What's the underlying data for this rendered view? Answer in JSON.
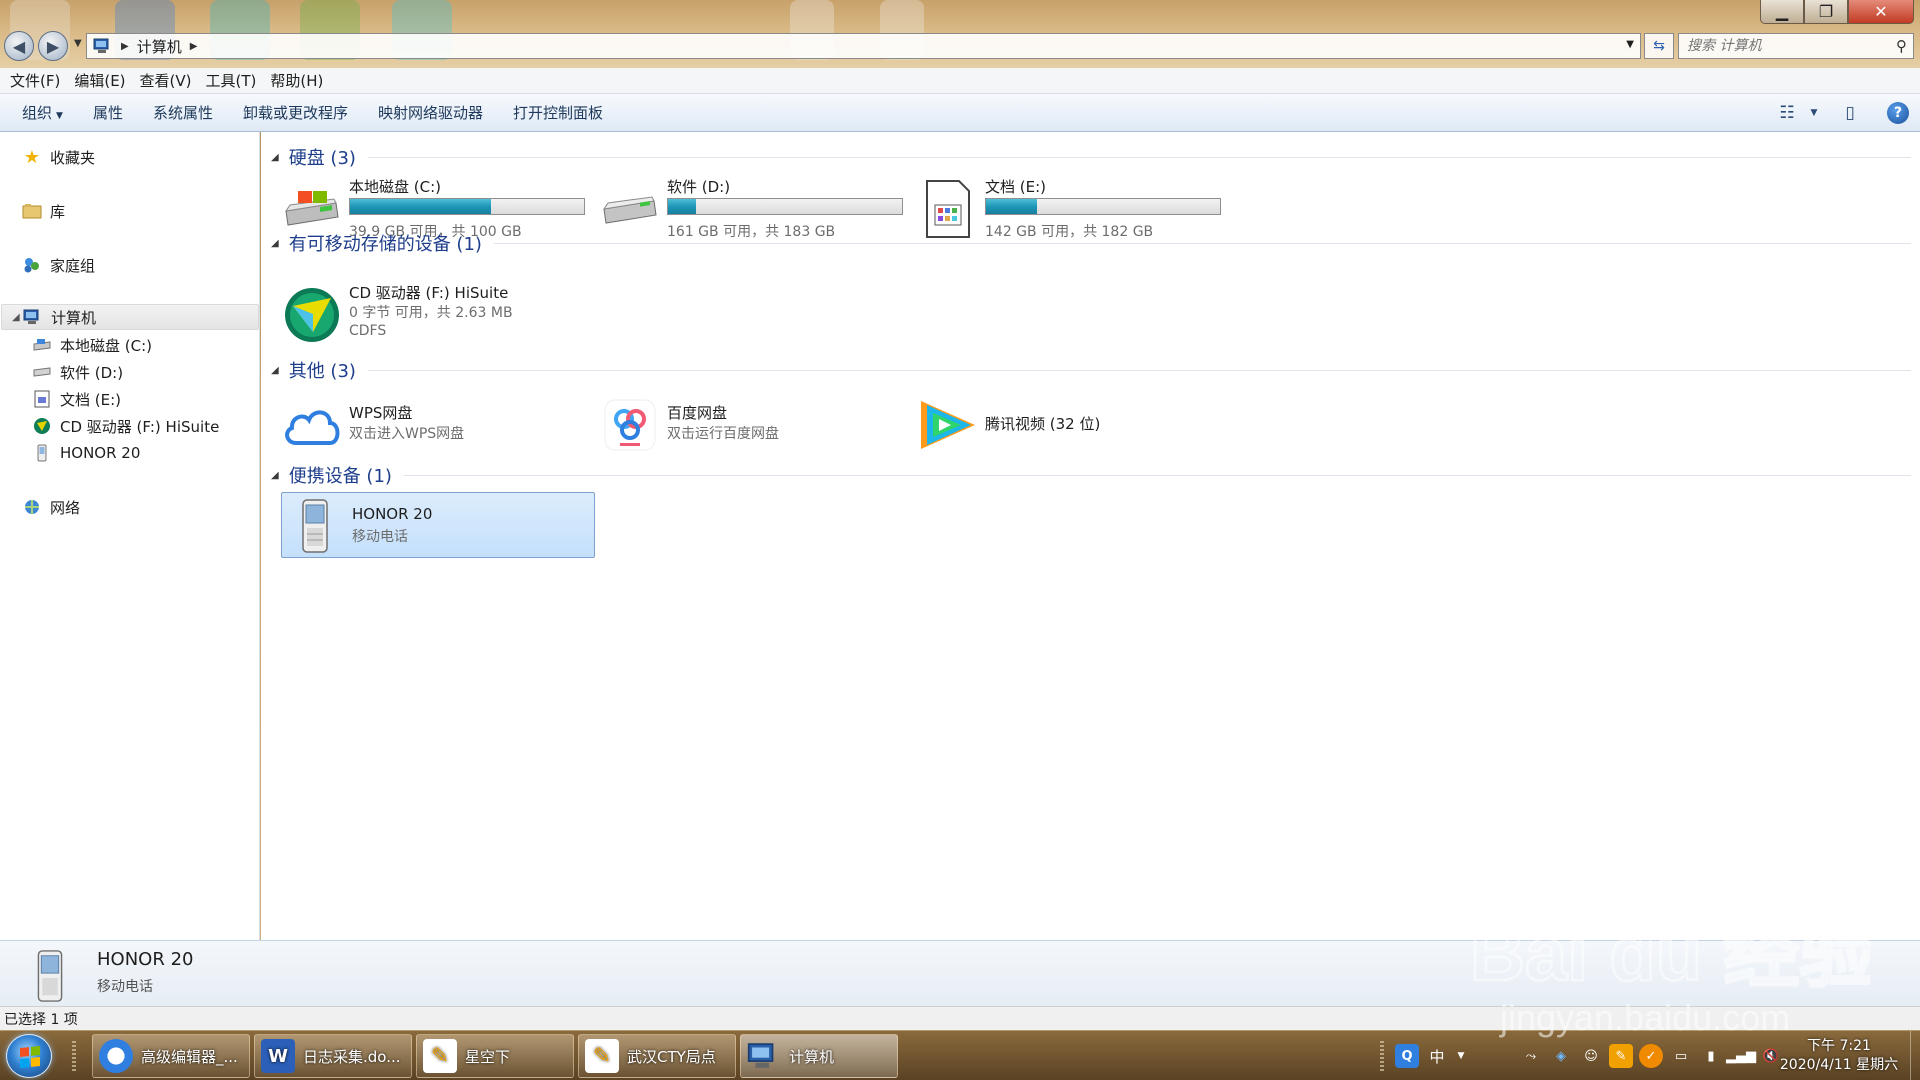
{
  "window": {
    "address_crumb": "计算机",
    "search_placeholder": "搜索 计算机",
    "controls": {
      "min": "▁",
      "max": "❐",
      "close": "✕"
    }
  },
  "menu": [
    "文件(F)",
    "编辑(E)",
    "查看(V)",
    "工具(T)",
    "帮助(H)"
  ],
  "toolbar": {
    "organize": "组织",
    "properties": "属性",
    "system_properties": "系统属性",
    "uninstall": "卸载或更改程序",
    "map_drive": "映射网络驱动器",
    "control_panel": "打开控制面板"
  },
  "nav": {
    "favorites": "收藏夹",
    "libraries": "库",
    "homegroup": "家庭组",
    "computer": "计算机",
    "computer_children": [
      "本地磁盘 (C:)",
      "软件 (D:)",
      "文档 (E:)",
      "CD 驱动器 (F:) HiSuite",
      "HONOR 20"
    ],
    "network": "网络"
  },
  "groups": {
    "hdd": {
      "title": "硬盘 (3)",
      "items": [
        {
          "name": "本地磁盘 (C:)",
          "sub": "39.9 GB 可用，共 100 GB",
          "used_fraction": 0.601
        },
        {
          "name": "软件 (D:)",
          "sub": "161 GB 可用，共 183 GB",
          "used_fraction": 0.12
        },
        {
          "name": "文档 (E:)",
          "sub": "142 GB 可用，共 182 GB",
          "used_fraction": 0.22
        }
      ]
    },
    "removable": {
      "title": "有可移动存储的设备 (1)",
      "items": [
        {
          "name": "CD 驱动器 (F:) HiSuite",
          "sub1": "0 字节 可用，共 2.63 MB",
          "sub2": "CDFS"
        }
      ]
    },
    "other": {
      "title": "其他 (3)",
      "items": [
        {
          "name": "WPS网盘",
          "sub": "双击进入WPS网盘"
        },
        {
          "name": "百度网盘",
          "sub": "双击运行百度网盘"
        },
        {
          "name": "腾讯视频 (32 位)"
        }
      ]
    },
    "portable": {
      "title": "便携设备 (1)",
      "items": [
        {
          "name": "HONOR 20",
          "sub": "移动电话"
        }
      ]
    }
  },
  "details": {
    "name": "HONOR 20",
    "sub": "移动电话"
  },
  "status": "已选择 1 项",
  "taskbar": {
    "tasks": [
      "高级编辑器_...",
      "日志采集.do...",
      "星空下",
      "武汉CTY局点",
      "计算机"
    ],
    "ime": "中",
    "clock_time": "下午 7:21",
    "clock_date": "2020/4/11 星期六"
  },
  "watermark": {
    "text": "Bai du 经验",
    "url": "jingyan.baidu.com"
  },
  "colors": {
    "accent": "#1e3e8c",
    "bar_fill": "#1e96b8",
    "selection": "#c4e0fc"
  }
}
